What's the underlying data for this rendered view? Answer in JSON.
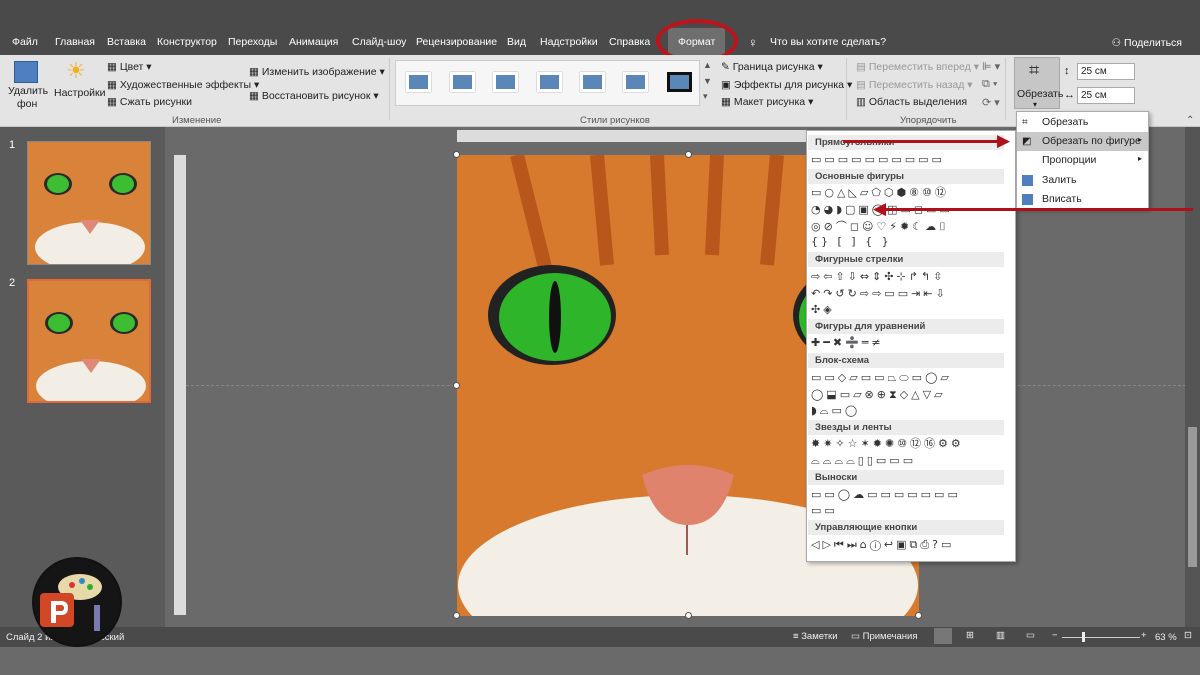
{
  "menu": {
    "tabs": [
      "Файл",
      "Главная",
      "Вставка",
      "Конструктор",
      "Переходы",
      "Анимация",
      "Слайд-шоу",
      "Рецензирование",
      "Вид",
      "Надстройки",
      "Справка",
      "Формат"
    ],
    "search": "Что вы хотите сделать?",
    "share": "Поделиться"
  },
  "ribbon": {
    "remove_bg": [
      "Удалить",
      "фон"
    ],
    "settings": "Настройки",
    "color": "Цвет",
    "art_effects": "Художественные эффекты",
    "compress": "Сжать рисунки",
    "change_picture": "Изменить изображение",
    "reset_picture": "Восстановить рисунок",
    "group_change": "Изменение",
    "group_styles": "Стили рисунков",
    "border": "Граница рисунка",
    "effects": "Эффекты для рисунка",
    "layout": "Макет рисунка",
    "bring_forward": "Переместить вперед",
    "send_backward": "Переместить назад",
    "selection_pane": "Область выделения",
    "group_arrange": "Упорядочить",
    "crop": "Обрезать",
    "height": "25 см",
    "width": "25 см"
  },
  "slides": [
    "1",
    "2"
  ],
  "shapes_panel": {
    "sections": [
      "Прямоугольники",
      "Основные фигуры",
      "Фигурные стрелки",
      "Фигуры для уравнений",
      "Блок-схема",
      "Звезды и ленты",
      "Выноски",
      "Управляющие кнопки"
    ]
  },
  "crop_menu": [
    "Обрезать",
    "Обрезать по фигуре",
    "Пропорции",
    "Залить",
    "Вписать"
  ],
  "status": {
    "slide": "Слайд 2 из",
    "lang": "сский",
    "notes": "Заметки",
    "comments": "Примечания",
    "zoom": "63 %"
  },
  "colors": {
    "accent": "#c0121a",
    "highlight": "#e0683a"
  }
}
